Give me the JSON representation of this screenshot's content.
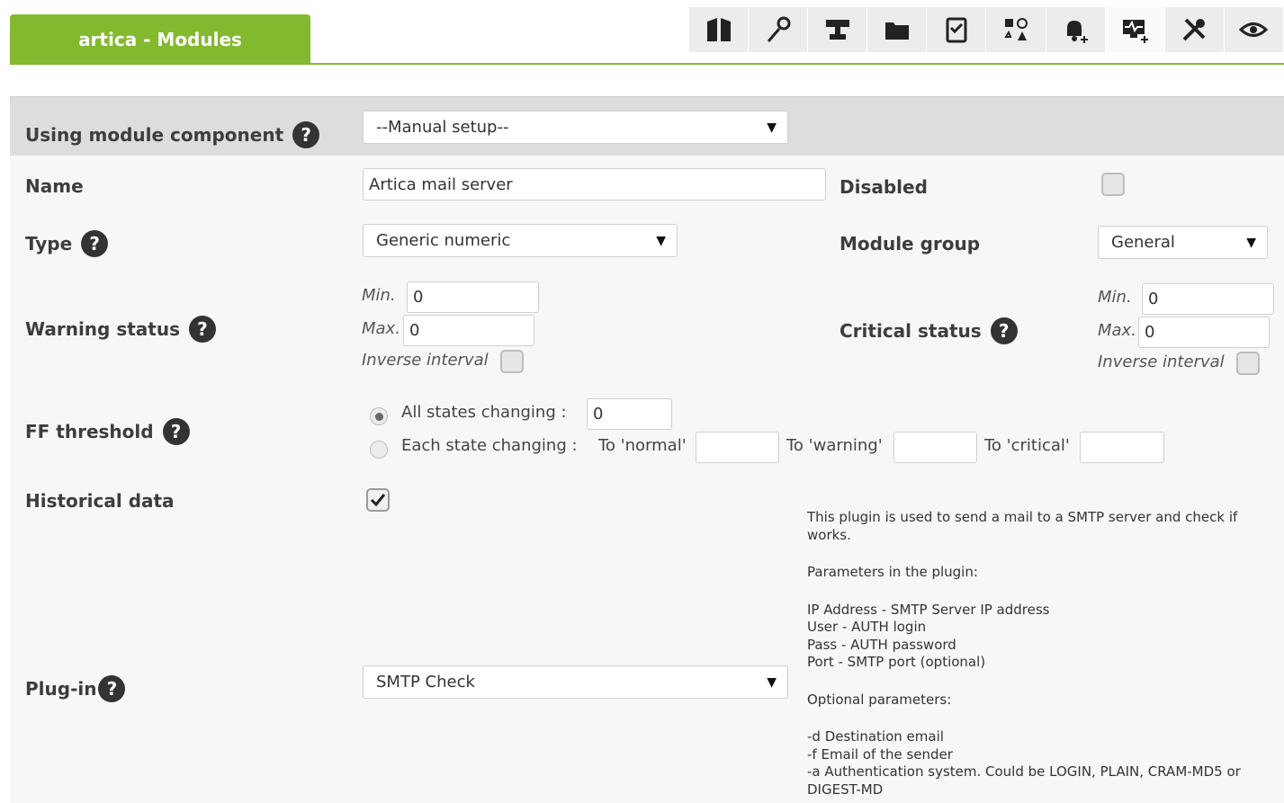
{
  "header": {
    "title": "artica - Modules",
    "toolbar_icons": [
      {
        "name": "manage-agents-icon"
      },
      {
        "name": "tools-icon"
      },
      {
        "name": "network-icon"
      },
      {
        "name": "folder-icon"
      },
      {
        "name": "checklist-icon"
      },
      {
        "name": "shapes-icon"
      },
      {
        "name": "alert-add-icon"
      },
      {
        "name": "monitor-add-icon",
        "active": true
      },
      {
        "name": "setup-icon"
      },
      {
        "name": "view-icon"
      }
    ]
  },
  "form": {
    "module_component": {
      "label": "Using module component",
      "value": "--Manual setup--"
    },
    "name": {
      "label": "Name",
      "value": "Artica mail server"
    },
    "disabled": {
      "label": "Disabled",
      "checked": false
    },
    "type": {
      "label": "Type",
      "value": "Generic numeric"
    },
    "module_group": {
      "label": "Module group",
      "value": "General"
    },
    "warning_status": {
      "label": "Warning status",
      "min_label": "Min.",
      "min_value": "0",
      "max_label": "Max.",
      "max_value": "0",
      "inverse_label": "Inverse interval",
      "inverse_checked": false
    },
    "critical_status": {
      "label": "Critical status",
      "min_label": "Min.",
      "min_value": "0",
      "max_label": "Max.",
      "max_value": "0",
      "inverse_label": "Inverse interval",
      "inverse_checked": false
    },
    "ff_threshold": {
      "label": "FF threshold",
      "all_states_label": "All states changing :",
      "all_states_value": "0",
      "each_state_label": "Each state changing :",
      "to_normal_label": "To 'normal'",
      "to_warning_label": "To 'warning'",
      "to_critical_label": "To 'critical'",
      "selected": "all"
    },
    "historical_data": {
      "label": "Historical data",
      "checked": true
    },
    "plugin": {
      "label": "Plug-in",
      "value": "SMTP Check",
      "description": [
        "This plugin is used to send a mail to a SMTP server and check if works.",
        "",
        "Parameters in the plugin:",
        "",
        "IP Address - SMTP Server IP address",
        "User - AUTH login",
        "Pass - AUTH password",
        "Port - SMTP port (optional)",
        "",
        "Optional parameters:",
        "",
        "-d Destination email",
        "-f Email of the sender",
        "-a Authentication system. Could be LOGIN, PLAIN, CRAM-MD5 or DIGEST-MD"
      ]
    },
    "help_glyph": "?",
    "dropdown_arrow": "▼"
  },
  "colors": {
    "accent": "#82b92e",
    "band": "#dddddd",
    "panel": "#f7f7f7"
  }
}
